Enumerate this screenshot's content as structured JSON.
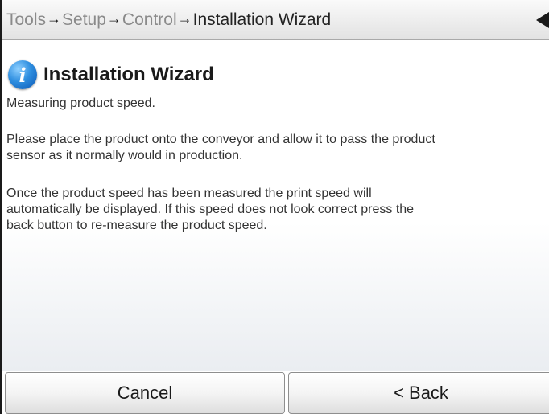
{
  "breadcrumb": {
    "items": [
      "Tools",
      "Setup",
      "Control",
      "Installation Wizard"
    ],
    "separator": "→"
  },
  "header": {
    "back_icon": "back-triangle-icon"
  },
  "main": {
    "icon": "info-icon",
    "icon_glyph": "i",
    "title": "Installation Wizard",
    "paragraphs": [
      "Measuring product speed.",
      "Please place the product onto the conveyor and allow it to pass the product\nsensor as it normally would in production.",
      "Once the product speed has been measured the print speed will\nautomatically be displayed. If this speed does not look correct press the\nback button to re-measure the product speed."
    ]
  },
  "footer": {
    "cancel_label": "Cancel",
    "back_label": "< Back"
  },
  "colors": {
    "accent": "#2f8fe0",
    "breadcrumb_inactive": "#8a8a8a",
    "breadcrumb_active": "#222222"
  }
}
